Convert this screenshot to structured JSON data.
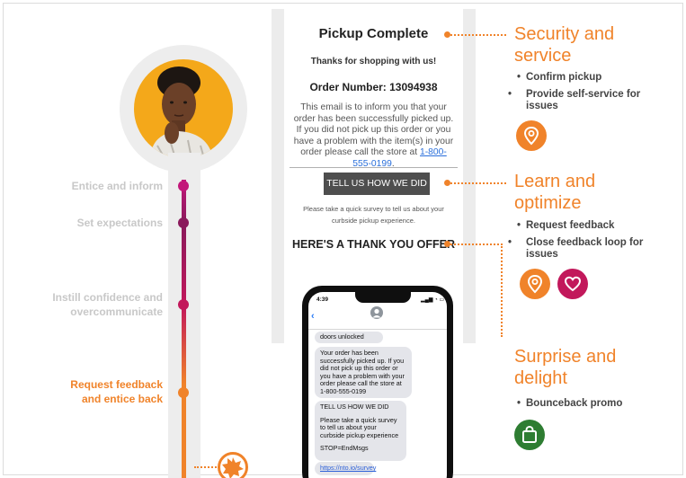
{
  "colors": {
    "accent": "#f0832a",
    "stage_line_top": "#c2185b",
    "stage_line_bottom": "#f0832a",
    "icon_orange": "#f0832a",
    "icon_plum": "#c2185b",
    "icon_green": "#2e7d32"
  },
  "journey": {
    "stages": [
      {
        "label": "Entice and inform",
        "state": "dim",
        "dot_color": "#c2187a"
      },
      {
        "label": "Set expectations",
        "state": "dim",
        "dot_color": "#8a1a5c"
      },
      {
        "label": "Instill confidence and overcommunicate",
        "state": "dim",
        "dot_color": "#c2185b"
      },
      {
        "label": "Request feedback and entice back",
        "state": "active",
        "dot_color": "#f0832a"
      }
    ],
    "avatar_icon": "person-thinking-avatar",
    "badge_icon": "starburst-badge-icon"
  },
  "email": {
    "title": "Pickup Complete",
    "thanks": "Thanks for shopping with us!",
    "order_number": "Order Number: 13094938",
    "body": "This email is to inform you that your order has been successfully picked up. If you did not pick up this order or you have a problem with the item(s) in your order please call the store at",
    "phone": "1-800-555-0199",
    "button": "TELL US HOW WE DID",
    "survey": "Please take a quick survey to tell us about your curbside pickup experience.",
    "offer": "HERE'S A THANK YOU OFFER"
  },
  "phone": {
    "time": "4:39",
    "status_icons": "signal-wifi-battery-icons",
    "messages": [
      {
        "text": "doors unlocked"
      },
      {
        "text": "Your order has been successfully picked up. If you did not pick up this order or you have a problem with your order please call the store at 1-800-555-0199"
      },
      {
        "text": "TELL US HOW WE DID"
      },
      {
        "text": "Please take a quick survey to tell us about your curbside pickup experience"
      },
      {
        "text": "STOP=EndMsgs"
      },
      {
        "text": "https://nto.io/survey"
      }
    ]
  },
  "annotations": {
    "security": {
      "title": "Security and service",
      "bullets": [
        "Confirm pickup",
        "Provide self-service for issues"
      ],
      "icon": "location-pin-icon"
    },
    "learn": {
      "title": "Learn and optimize",
      "bullets": [
        "Request feedback",
        "Close feedback loop for issues"
      ],
      "icons": [
        "location-pin-icon",
        "heart-icon"
      ]
    },
    "surprise": {
      "title": "Surprise and delight",
      "bullets": [
        "Bounceback promo"
      ],
      "icon": "shopping-bag-icon"
    }
  }
}
